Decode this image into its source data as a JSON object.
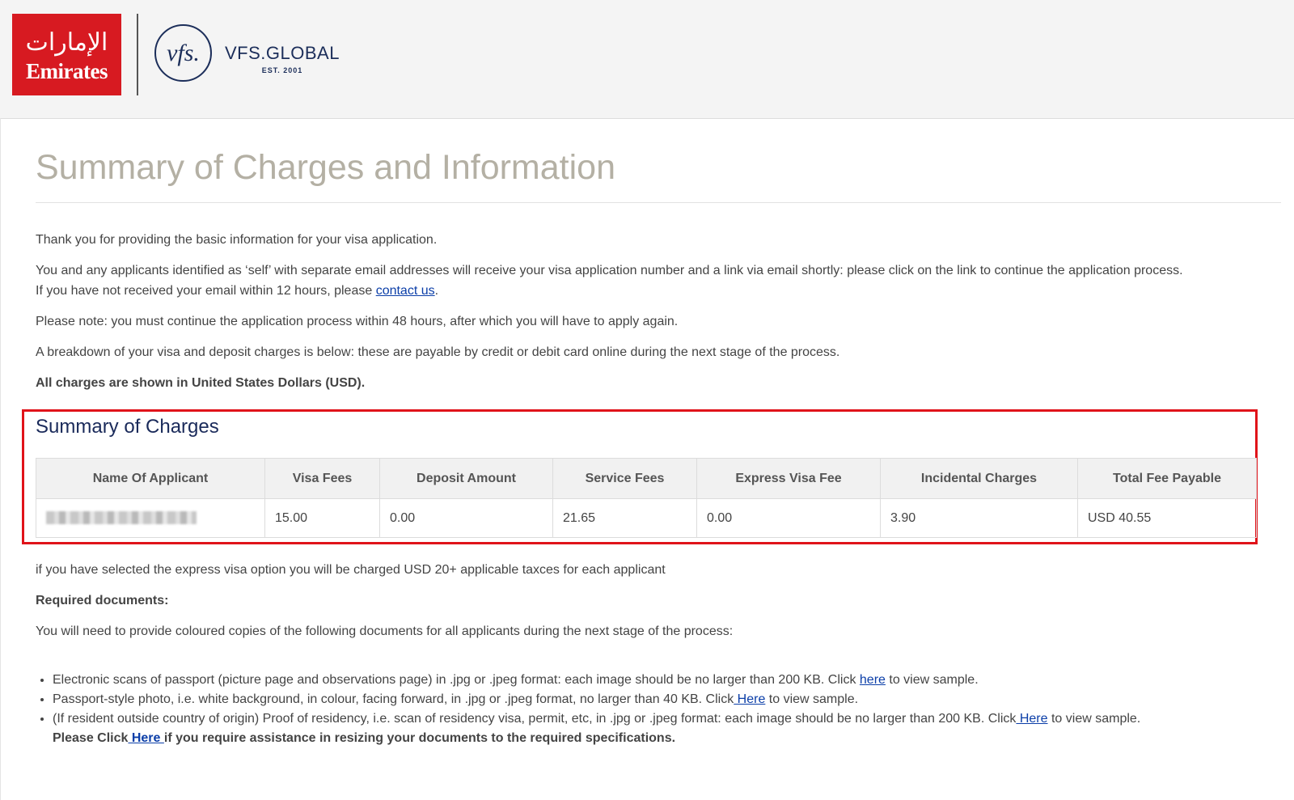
{
  "header": {
    "emirates_logo": {
      "calligraphy": "ﺍﻹﻣﺎﺭﺍﺕ",
      "wordmark": "Emirates",
      "color": "#d71a21"
    },
    "vfs_logo": {
      "monogram": "vfs.",
      "name": "VFS.GLOBAL",
      "est": "EST. 2001",
      "color": "#1c2e5a"
    }
  },
  "page": {
    "title": "Summary of Charges and Information",
    "para1": "Thank you for providing the basic information for your visa application.",
    "para2_line1": "You and any applicants identified as ‘self’ with separate email addresses will receive your visa application number and a link via email shortly: please click on the link to continue the application process.",
    "para2_line2_prefix": "If you have not received your email within 12 hours, please ",
    "contact_link": "contact us",
    "para2_suffix": ".",
    "para3": "Please note: you must continue the application process within 48 hours, after which you will have to apply again.",
    "para4": "A breakdown of your visa and deposit charges is below: these are payable by credit or debit card online during the next stage of the process.",
    "para5": "All charges are shown in United States Dollars (USD)."
  },
  "charges": {
    "title": "Summary of Charges",
    "headers": [
      "Name Of Applicant",
      "Visa Fees",
      "Deposit Amount",
      "Service Fees",
      "Express Visa Fee",
      "Incidental Charges",
      "Total Fee Payable"
    ],
    "row": {
      "name": "",
      "visa_fees": "15.00",
      "deposit_amount": "0.00",
      "service_fees": "21.65",
      "express_visa_fee": "0.00",
      "incidental_charges": "3.90",
      "total": "USD 40.55"
    },
    "highlight_color": "#e0131a"
  },
  "after": {
    "express_note": "if you have selected the express visa option you will be charged USD 20+ applicable taxces for each applicant",
    "required_heading": "Required documents:",
    "required_intro": "You will need to provide coloured copies of the following documents for all applicants during the next stage of the process:",
    "doc1_text": "Electronic scans of passport (picture page and observations page) in .jpg or .jpeg format: each image should be no larger than 200 KB. Click ",
    "doc1_link": "here",
    "doc1_suffix": " to view sample.",
    "doc2_text": "Passport-style photo, i.e. white background, in colour, facing forward, in .jpg or .jpeg format, no larger than 40 KB. Click",
    "doc2_link": " Here",
    "doc2_suffix": " to view sample.",
    "doc3_text": "(If resident outside country of origin) Proof of residency, i.e. scan of residency visa, permit, etc, in .jpg or .jpeg format: each image should be no larger than 200 KB. Click",
    "doc3_link": " Here",
    "doc3_suffix": " to view sample.",
    "assist_prefix": "Please Click",
    "assist_link": " Here ",
    "assist_suffix": "if you require assistance in resizing your documents to the required specifications."
  }
}
